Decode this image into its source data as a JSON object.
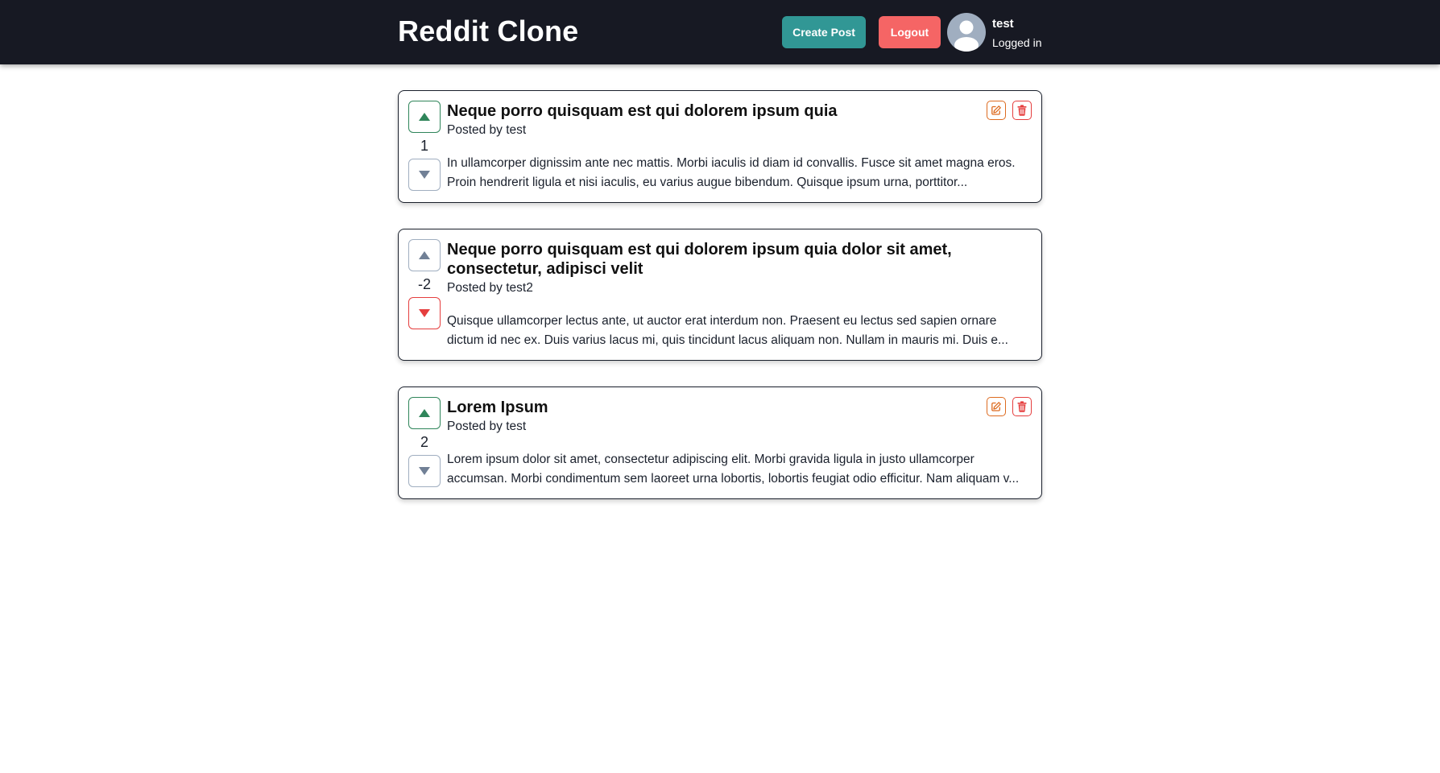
{
  "app": {
    "title": "Reddit Clone"
  },
  "header": {
    "create_post_label": "Create Post",
    "logout_label": "Logout",
    "user": {
      "name": "test",
      "status": "Logged in"
    }
  },
  "colors": {
    "navbar": "#171923",
    "create_button": "#319795",
    "logout_button": "#f56565",
    "upvote_active": "#2f855a",
    "downvote_active": "#e53e3e",
    "vote_inactive": "#718096",
    "edit_icon": "#dd6b20",
    "delete_icon": "#e53e3e"
  },
  "icons": {
    "avatar": "user-avatar-icon",
    "upvote": "triangle-up-icon",
    "downvote": "triangle-down-icon",
    "edit": "edit-icon",
    "delete": "trash-icon"
  },
  "posts": [
    {
      "title": "Neque porro quisquam est qui dolorem ipsum quia",
      "author": "Posted by test",
      "body": "In ullamcorper dignissim ante nec mattis. Morbi iaculis id diam id convallis. Fusce sit amet magna eros. Proin hendrerit ligula et nisi iaculis, eu varius augue bibendum. Quisque ipsum urna, porttitor...",
      "votes": "1",
      "vote_state": "up",
      "editable": true
    },
    {
      "title": "Neque porro quisquam est qui dolorem ipsum quia dolor sit amet, consectetur, adipisci velit",
      "author": "Posted by test2",
      "body": "Quisque ullamcorper lectus ante, ut auctor erat interdum non. Praesent eu lectus sed sapien ornare dictum id nec ex. Duis varius lacus mi, quis tincidunt lacus aliquam non. Nullam in mauris mi. Duis e...",
      "votes": "-2",
      "vote_state": "down",
      "editable": false
    },
    {
      "title": "Lorem Ipsum",
      "author": "Posted by test",
      "body": "Lorem ipsum dolor sit amet, consectetur adipiscing elit. Morbi gravida ligula in justo ullamcorper accumsan. Morbi condimentum sem laoreet urna lobortis, lobortis feugiat odio efficitur. Nam aliquam v...",
      "votes": "2",
      "vote_state": "up",
      "editable": true
    }
  ]
}
